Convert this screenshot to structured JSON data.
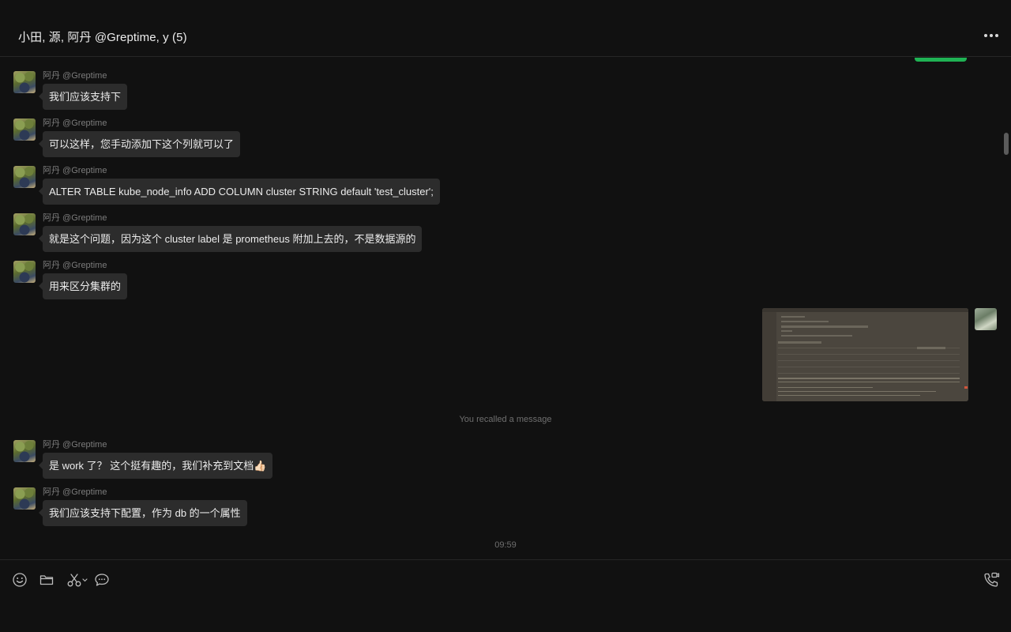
{
  "header": {
    "title": "小田, 源, 阿丹 @Greptime, y  (5)"
  },
  "messages": [
    {
      "sender": "阿丹 @Greptime",
      "text": "我们应该支持下"
    },
    {
      "sender": "阿丹 @Greptime",
      "text": "可以这样，您手动添加下这个列就可以了"
    },
    {
      "sender": "阿丹 @Greptime",
      "text": "ALTER TABLE kube_node_info ADD COLUMN cluster STRING default 'test_cluster';"
    },
    {
      "sender": "阿丹 @Greptime",
      "text": "就是这个问题，因为这个 cluster label 是 prometheus 附加上去的，不是数据源的"
    },
    {
      "sender": "阿丹 @Greptime",
      "text": "用来区分集群的"
    }
  ],
  "system_note": "You recalled a message",
  "later_messages": [
    {
      "sender": "阿丹 @Greptime",
      "text": "是 work 了？ 这个挺有趣的，我们补充到文档👍🏻"
    },
    {
      "sender": "阿丹 @Greptime",
      "text": "我们应该支持下配置，作为 db 的一个属性"
    }
  ],
  "timestamp": "09:59",
  "composer": {
    "value": "",
    "tools": [
      "emoji-icon",
      "folder-icon",
      "scissors-icon",
      "chat-bubble-icon"
    ],
    "call_icon": "phone-video-call-icon"
  },
  "colors": {
    "background": "#111111",
    "bubble": "#2c2c2c",
    "accent_green": "#1fb254"
  }
}
